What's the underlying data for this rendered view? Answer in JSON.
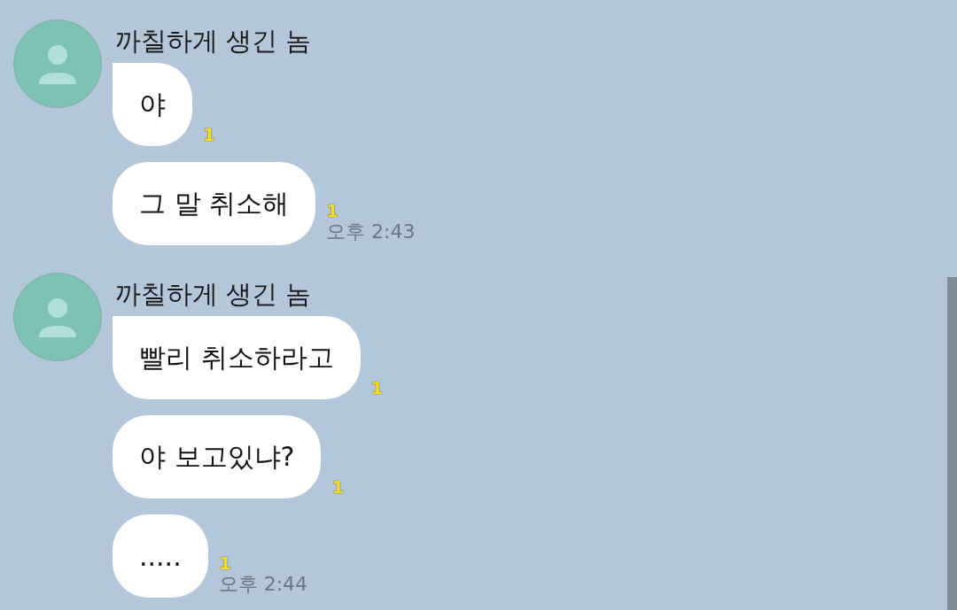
{
  "groups": [
    {
      "sender": "까칠하게 생긴 놈",
      "messages": [
        {
          "text": "야",
          "unread": "1"
        },
        {
          "text": "그 말 취소해",
          "unread": "1",
          "time": "오후 2:43"
        }
      ]
    },
    {
      "sender": "까칠하게 생긴 놈",
      "messages": [
        {
          "text": "빨리 취소하라고",
          "unread": "1"
        },
        {
          "text": "야 보고있냐?",
          "unread": "1"
        },
        {
          "text": ".....",
          "unread": "1",
          "time": "오후 2:44"
        }
      ]
    }
  ]
}
